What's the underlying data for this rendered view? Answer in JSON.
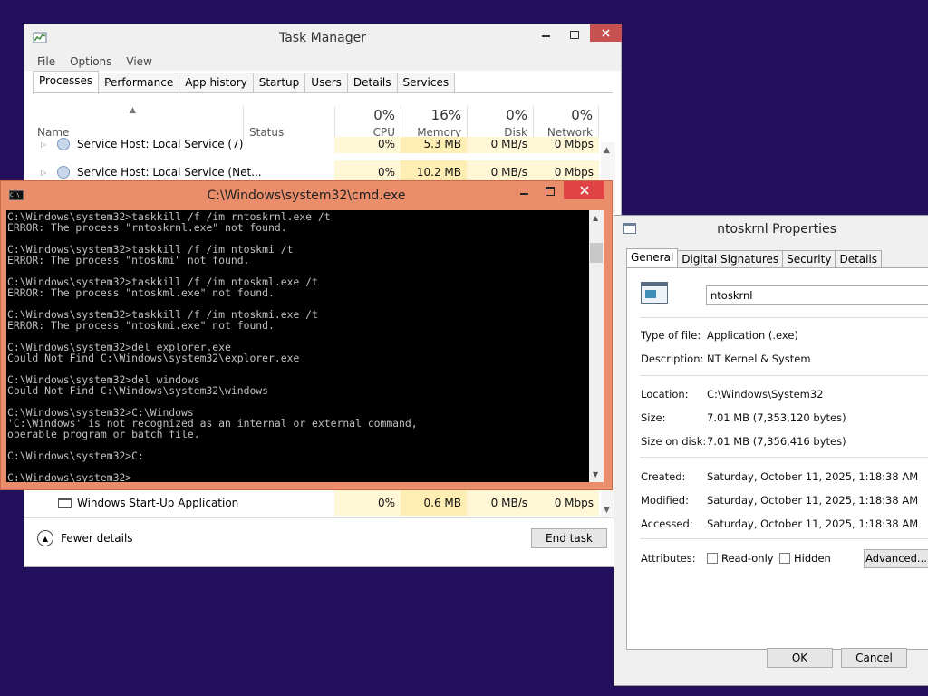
{
  "task_manager": {
    "title": "Task Manager",
    "menu": [
      "File",
      "Options",
      "View"
    ],
    "tabs": [
      "Processes",
      "Performance",
      "App history",
      "Startup",
      "Users",
      "Details",
      "Services"
    ],
    "columns": {
      "name": "Name",
      "status": "Status",
      "cpu": {
        "pct": "0%",
        "label": "CPU"
      },
      "memory": {
        "pct": "16%",
        "label": "Memory"
      },
      "disk": {
        "pct": "0%",
        "label": "Disk"
      },
      "network": {
        "pct": "0%",
        "label": "Network"
      }
    },
    "rows": [
      {
        "name": "Service Host: Local Service (7)",
        "cpu": "0%",
        "memory": "5.3 MB",
        "disk": "0 MB/s",
        "network": "0 Mbps"
      },
      {
        "name": "Service Host: Local Service (Net...",
        "cpu": "0%",
        "memory": "10.2 MB",
        "disk": "0 MB/s",
        "network": "0 Mbps"
      },
      {
        "name": "Windows Start-Up Application",
        "cpu": "0%",
        "memory": "0.6 MB",
        "disk": "0 MB/s",
        "network": "0 Mbps"
      }
    ],
    "fewer_details": "Fewer details",
    "end_task": "End task"
  },
  "cmd": {
    "title": "C:\\Windows\\system32\\cmd.exe",
    "lines": [
      "C:\\Windows\\system32>taskkill /f /im rntoskrnl.exe /t",
      "ERROR: The process \"rntoskrnl.exe\" not found.",
      "",
      "C:\\Windows\\system32>taskkill /f /im ntoskmi /t",
      "ERROR: The process \"ntoskmi\" not found.",
      "",
      "C:\\Windows\\system32>taskkill /f /im ntoskml.exe /t",
      "ERROR: The process \"ntoskml.exe\" not found.",
      "",
      "C:\\Windows\\system32>taskkill /f /im ntoskmi.exe /t",
      "ERROR: The process \"ntoskmi.exe\" not found.",
      "",
      "C:\\Windows\\system32>del explorer.exe",
      "Could Not Find C:\\Windows\\system32\\explorer.exe",
      "",
      "C:\\Windows\\system32>del windows",
      "Could Not Find C:\\Windows\\system32\\windows",
      "",
      "C:\\Windows\\system32>C:\\Windows",
      "'C:\\Windows' is not recognized as an internal or external command,",
      "operable program or batch file.",
      "",
      "C:\\Windows\\system32>C:",
      "",
      "C:\\Windows\\system32>"
    ]
  },
  "properties": {
    "title": "ntoskrnl Properties",
    "tabs": [
      "General",
      "Digital Signatures",
      "Security",
      "Details"
    ],
    "filename": "ntoskrnl",
    "type_label": "Type of file:",
    "type_value": "Application (.exe)",
    "desc_label": "Description:",
    "desc_value": "NT Kernel & System",
    "location_label": "Location:",
    "location_value": "C:\\Windows\\System32",
    "size_label": "Size:",
    "size_value": "7.01 MB (7,353,120 bytes)",
    "sizedisk_label": "Size on disk:",
    "sizedisk_value": "7.01 MB (7,356,416 bytes)",
    "created_label": "Created:",
    "created_value": "Saturday, October 11, 2025, 1:18:38 AM",
    "modified_label": "Modified:",
    "modified_value": "Saturday, October 11, 2025, 1:18:38 AM",
    "accessed_label": "Accessed:",
    "accessed_value": "Saturday, October 11, 2025, 1:18:38 AM",
    "attributes_label": "Attributes:",
    "readonly_label": "Read-only",
    "hidden_label": "Hidden",
    "advanced_label": "Advanced...",
    "ok_label": "OK",
    "cancel_label": "Cancel"
  },
  "colors": {
    "desktop": "#22105c",
    "cmd_accent": "#e98d6b",
    "close_red": "#e04343",
    "cpu_highlight": "#fff7d6",
    "memory_highlight": "#ffeeb4"
  }
}
